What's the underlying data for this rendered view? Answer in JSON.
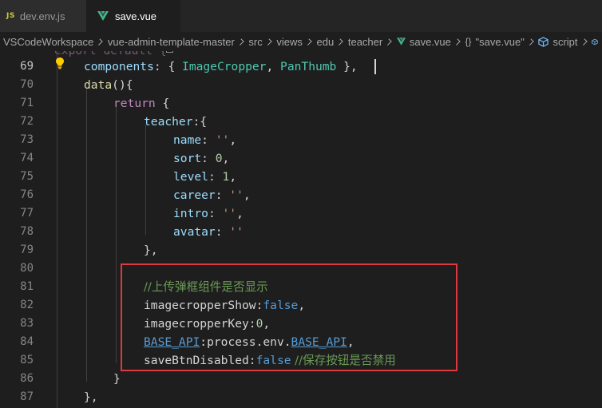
{
  "tabs": [
    {
      "icon": "JS",
      "label": "dev.env.js",
      "active": false
    },
    {
      "label": "save.vue",
      "active": true
    }
  ],
  "breadcrumb": {
    "items": [
      "VSCodeWorkspace",
      "vue-admin-template-master",
      "src",
      "views",
      "edu",
      "teacher",
      "save.vue"
    ],
    "symbol_braces": "{}",
    "symbol_name": "\"save.vue\"",
    "symbol_script": "script"
  },
  "editor": {
    "partial_top_text": "export default {",
    "line_numbers": [
      "69",
      "70",
      "71",
      "72",
      "73",
      "74",
      "75",
      "76",
      "77",
      "78",
      "79",
      "80",
      "81",
      "82",
      "83",
      "84",
      "85",
      "86",
      "87"
    ],
    "active_line": "69",
    "code": {
      "l69_key": "components",
      "l69_colon": ": { ",
      "l69_c1": "ImageCropper",
      "l69_comma": ", ",
      "l69_c2": "PanThumb",
      "l69_end": " },",
      "l70_fn": "data",
      "l70_rest": "(){",
      "l71_kw": "return",
      "l71_rest": " {",
      "l72_key": "teacher",
      "l72_rest": ":{",
      "l73_key": "name",
      "l73_colon": ": ",
      "l73_val": "''",
      "l73_end": ",",
      "l74_key": "sort",
      "l74_colon": ": ",
      "l74_val": "0",
      "l74_end": ",",
      "l75_key": "level",
      "l75_colon": ": ",
      "l75_val": "1",
      "l75_end": ",",
      "l76_key": "career",
      "l76_colon": ": ",
      "l76_val": "''",
      "l76_end": ",",
      "l77_key": "intro",
      "l77_colon": ": ",
      "l77_val": "''",
      "l77_end": ",",
      "l78_key": "avatar",
      "l78_colon": ": ",
      "l78_val": "''",
      "l79_text": "},",
      "l81_comment": "//上传弹框组件是否显示",
      "l82_key": "imagecropperShow",
      "l82_colon": ":",
      "l82_val": "false",
      "l82_end": ",",
      "l83_key": "imagecropperKey",
      "l83_colon": ":",
      "l83_val": "0",
      "l83_end": ",",
      "l84_key": "BASE_API",
      "l84_mid1": ":process.env.",
      "l84_env": "BASE_API",
      "l84_end": ",",
      "l85_key": "saveBtnDisabled",
      "l85_colon": ":",
      "l85_val": "false",
      "l85_comment": " //保存按钮是否禁用",
      "l86_text": "}",
      "l87_text": "},"
    }
  },
  "colors": {
    "keyword": "#c586c0",
    "property": "#9cdcfe",
    "function": "#dcdcaa",
    "class": "#4ec9b0",
    "string": "#ce9178",
    "number": "#b5cea8",
    "boolean": "#569cd6",
    "comment": "#6a9955",
    "highlight_box": "#e0383e"
  }
}
